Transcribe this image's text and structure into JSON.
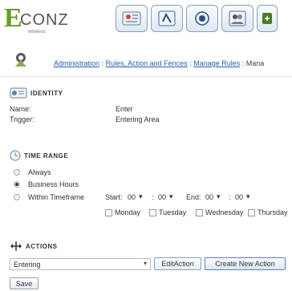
{
  "logo": {
    "brand_letter": "E",
    "brand_rest": "CONZ",
    "tagline": "wireless"
  },
  "breadcrumb": {
    "items": [
      "Administration",
      "Rules, Action and Fences",
      "Manage Rules",
      "Mana"
    ],
    "separator": ":"
  },
  "identity": {
    "heading": "IDENTITY",
    "name_label": "Name:",
    "name_value": "Enter",
    "trigger_label": "Trigger:",
    "trigger_value": "Entering Area"
  },
  "time_range": {
    "heading": "TIME RANGE",
    "options": [
      "Always",
      "Business Hours",
      "Within Timeframe"
    ],
    "selected_option": "Business Hours",
    "start_label": "Start:",
    "start_hour": "00",
    "start_minute": "00",
    "end_label": "End:",
    "end_hour": "00",
    "end_minute": "00",
    "time_separator": ":",
    "days": [
      "Monday",
      "Tuesday",
      "Wednesday",
      "Thursday"
    ]
  },
  "actions": {
    "heading": "ACTIONS",
    "selected_action": "Entering",
    "edit_label": "EditAction",
    "create_label": "Create New Action"
  },
  "save_label": "Save",
  "colors": {
    "accent": "#2a5db0",
    "brand_green": "#6a9a2a"
  }
}
